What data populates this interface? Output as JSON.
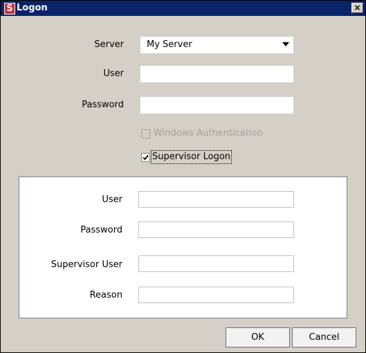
{
  "window": {
    "app_icon_letter": "S",
    "title": "Logon",
    "close_label": "×"
  },
  "login": {
    "server_label": "Server",
    "server_value": "My Server",
    "user_label": "User",
    "user_value": "",
    "password_label": "Password",
    "password_value": ""
  },
  "options": {
    "windows_auth_label": "Windows Authentication",
    "windows_auth_checked": false,
    "windows_auth_enabled": false,
    "supervisor_logon_label": "Supervisor Logon",
    "supervisor_logon_checked": true
  },
  "supervisor": {
    "user_label": "User",
    "user_value": "",
    "password_label": "Password",
    "password_value": "",
    "supervisor_user_label": "Supervisor User",
    "supervisor_user_value": "",
    "reason_label": "Reason",
    "reason_value": ""
  },
  "buttons": {
    "ok_label": "OK",
    "cancel_label": "Cancel"
  }
}
